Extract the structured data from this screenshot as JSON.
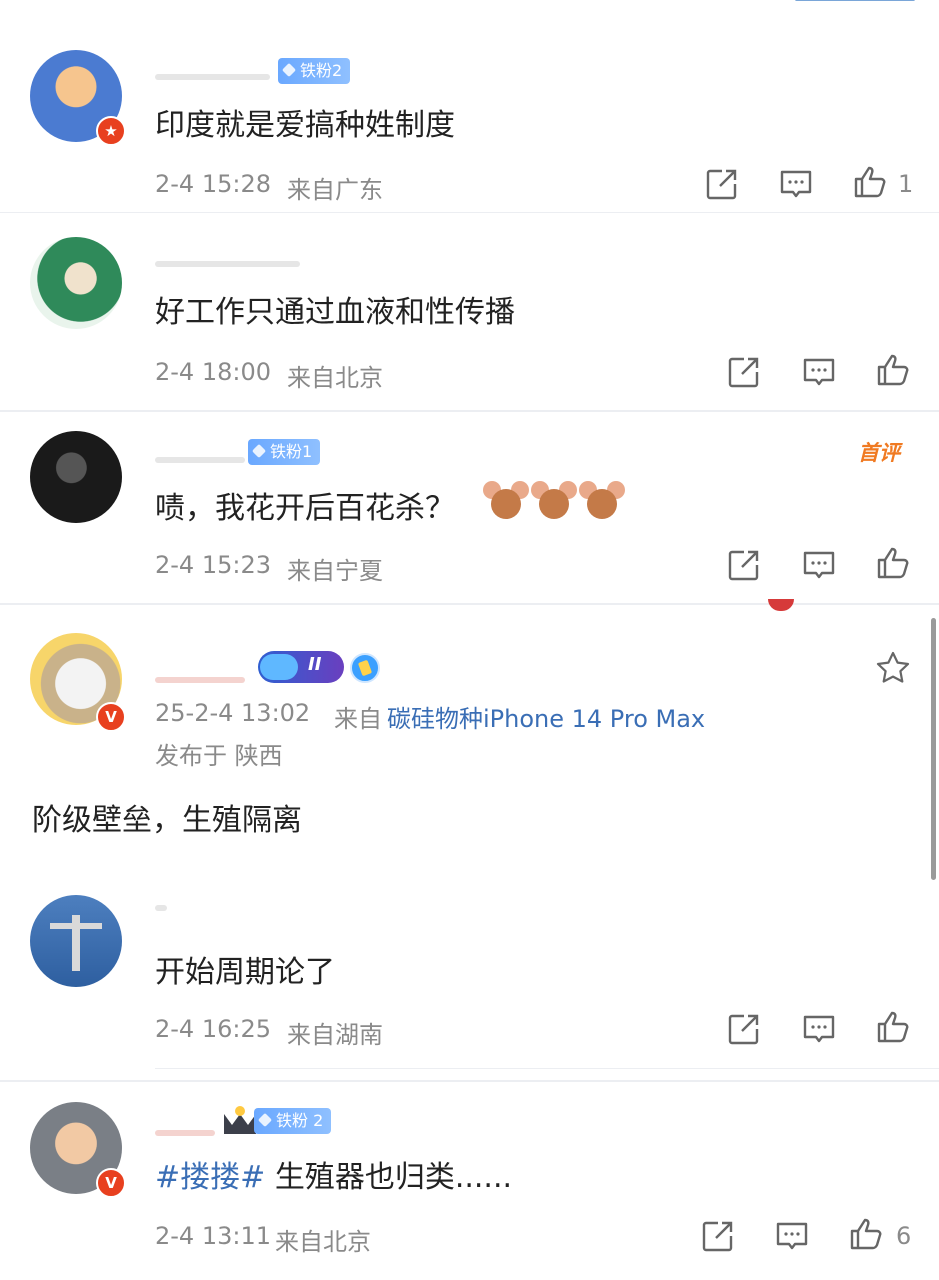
{
  "comments": [
    {
      "fan_badge": "铁粉2",
      "text": "印度就是爱搞种姓制度",
      "time": "2-4 15:28",
      "location": "来自广东",
      "likes": "1"
    },
    {
      "fan_badge": "",
      "text": "好工作只通过血液和性传播",
      "time": "2-4 18:00",
      "location": "来自北京",
      "likes": ""
    },
    {
      "fan_badge": "铁粉1",
      "text": "啧，我花开后百花杀？",
      "time": "2-4 15:23",
      "location": "来自宁夏",
      "likes": "",
      "top_badge": "首评"
    }
  ],
  "post": {
    "time": "25-2-4 13:02",
    "source_prefix": "来自",
    "source": "碳硅物种iPhone 14 Pro Max",
    "published_in": "发布于 陕西",
    "text": "阶级壁垒，生殖隔离",
    "level_badge": "II"
  },
  "replies": [
    {
      "text": "开始周期论了",
      "time": "2-4 16:25",
      "location": "来自湖南",
      "likes": ""
    },
    {
      "fan_badge": "铁粉 2",
      "topic": "#搂搂#",
      "text": " 生殖器也归类......",
      "time": "2-4 13:11",
      "location": "来自北京",
      "likes": "6"
    }
  ],
  "icons": {
    "share": "share-icon",
    "comment": "comment-icon",
    "like": "thumbs-up-icon",
    "star": "star-icon"
  },
  "colors": {
    "link": "#3a6eb5",
    "badge_red": "#e8401f",
    "fan_badge": "#7ab4ff",
    "muted": "#8a8a8a"
  }
}
